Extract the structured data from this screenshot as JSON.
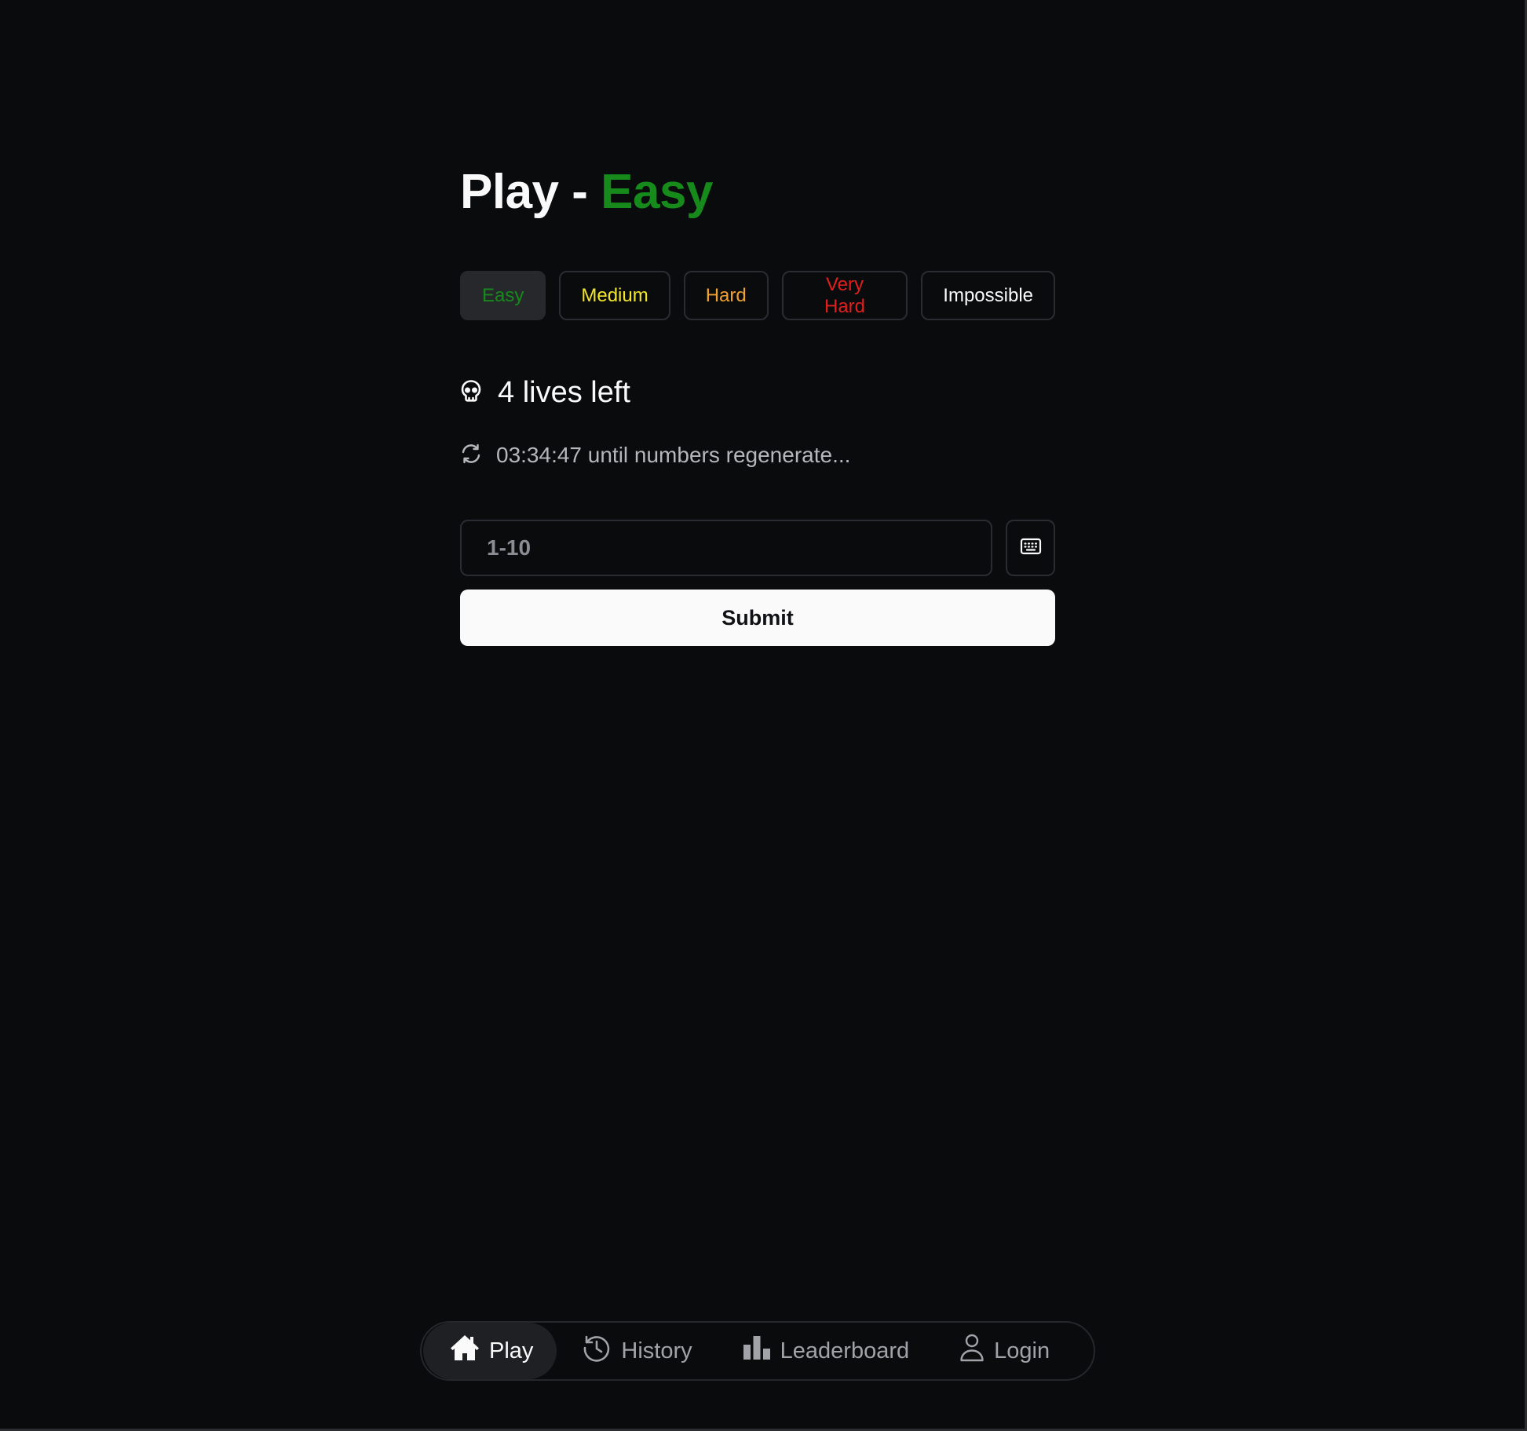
{
  "header": {
    "title_prefix": "Play - ",
    "title_level": "Easy"
  },
  "difficulties": [
    {
      "label": "Easy",
      "color": "#168a1b",
      "active": true
    },
    {
      "label": "Medium",
      "color": "#f2e52a",
      "active": false
    },
    {
      "label": "Hard",
      "color": "#f0a12e",
      "active": false
    },
    {
      "label": "Very Hard",
      "color": "#e1201e",
      "active": false
    },
    {
      "label": "Impossible",
      "color": "#fafafa",
      "active": false
    }
  ],
  "status": {
    "lives_text": "4 lives left",
    "lives_icon": "skull-icon",
    "timer_text": "03:34:47 until numbers regenerate...",
    "timer_icon": "refresh-icon"
  },
  "guess": {
    "placeholder": "1-10",
    "value": "",
    "keyboard_icon": "keyboard-icon",
    "submit_label": "Submit"
  },
  "nav": {
    "items": [
      {
        "label": "Play",
        "icon": "home-icon",
        "active": true
      },
      {
        "label": "History",
        "icon": "history-icon",
        "active": false
      },
      {
        "label": "Leaderboard",
        "icon": "bar-chart-icon",
        "active": false
      },
      {
        "label": "Login",
        "icon": "user-icon",
        "active": false
      }
    ]
  },
  "colors": {
    "background": "#0a0b0d",
    "accent_easy": "#168a1b",
    "text_primary": "#fafafa",
    "text_muted": "#b6b7bb"
  }
}
